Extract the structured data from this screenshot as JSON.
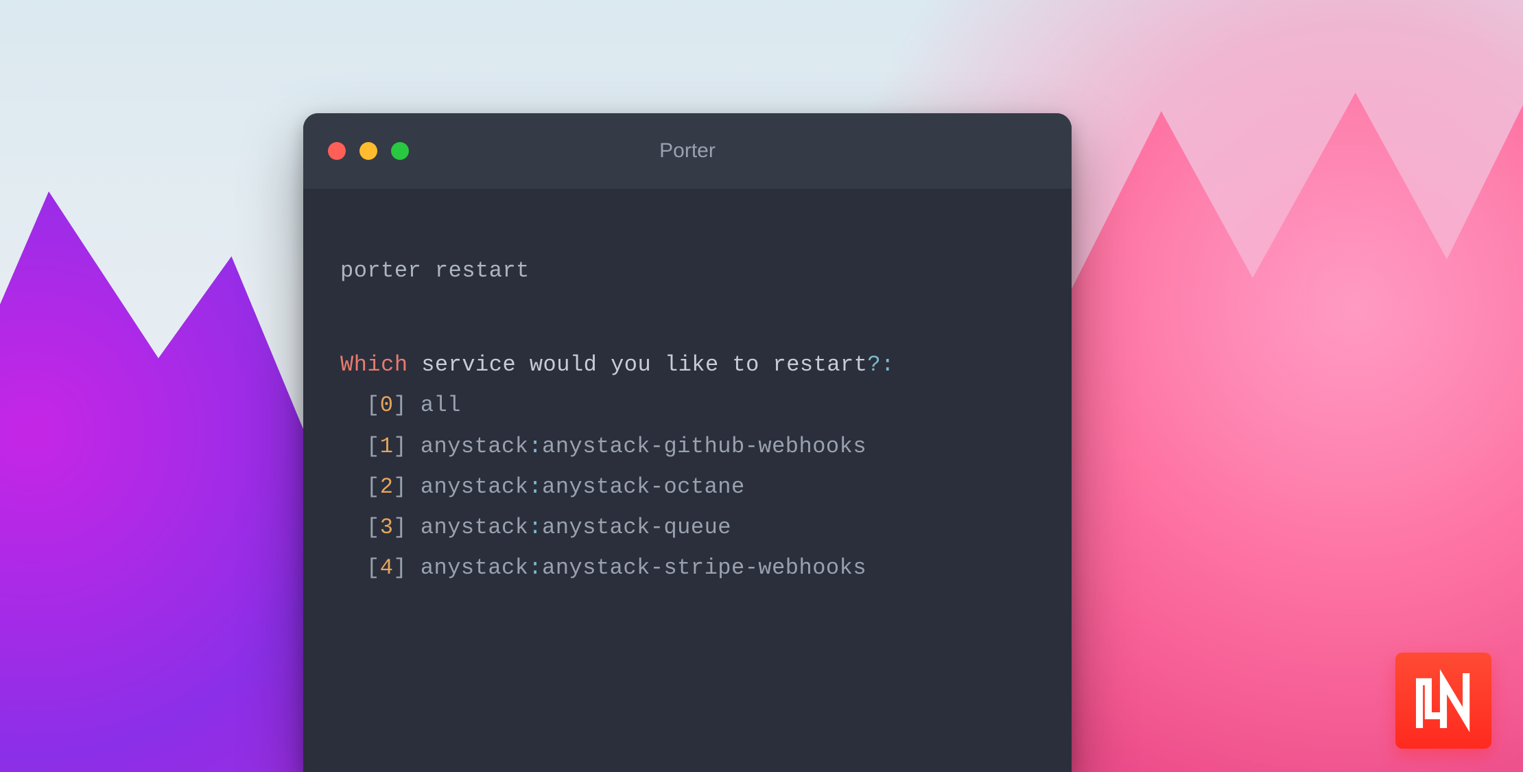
{
  "window": {
    "title": "Porter"
  },
  "terminal": {
    "command": "porter restart",
    "prompt": {
      "which": "Which",
      "text": " service would you like to restart",
      "qcol": "?:"
    },
    "options": [
      {
        "index": "0",
        "label": "all"
      },
      {
        "index": "1",
        "label_pre": "anystack",
        "label_post": "anystack-github-webhooks"
      },
      {
        "index": "2",
        "label_pre": "anystack",
        "label_post": "anystack-octane"
      },
      {
        "index": "3",
        "label_pre": "anystack",
        "label_post": "anystack-queue"
      },
      {
        "index": "4",
        "label_pre": "anystack",
        "label_post": "anystack-stripe-webhooks"
      }
    ]
  },
  "logo": {
    "letters": "LN"
  }
}
